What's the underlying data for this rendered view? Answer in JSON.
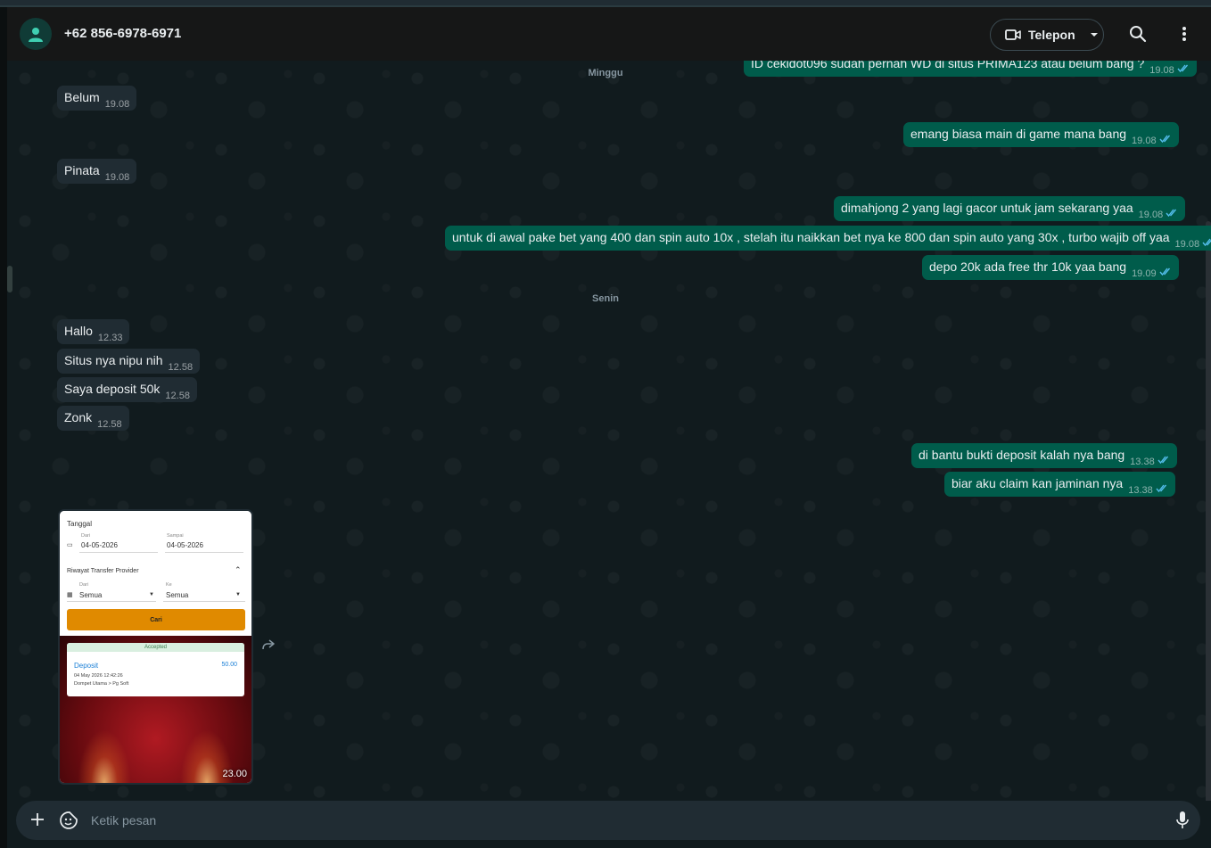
{
  "header": {
    "contact_name": "+62 856-6978-6971",
    "call_label": "Telepon"
  },
  "icons": {
    "avatar": "person-icon",
    "call": "video-camera-icon",
    "dropdown": "chevron-down-icon",
    "search": "search-icon",
    "menu": "kebab-menu-icon",
    "forward": "forward-icon",
    "attach": "plus-icon",
    "sticker": "sticker-icon",
    "mic": "microphone-icon",
    "read": "double-check-icon"
  },
  "colors": {
    "incoming_bubble": "#202c33",
    "outgoing_bubble": "#005c4b",
    "read_ticks": "#53bdeb",
    "cari_button": "#e08a00"
  },
  "chat": {
    "day_minggu": "Minggu",
    "day_senin": "Senin",
    "messages": [
      {
        "dir": "out",
        "text": "ID cekidot096 sudah pernah WD di situs PRIMA123 atau belum bang ?",
        "time": "19.08"
      },
      {
        "dir": "in",
        "text": "Belum",
        "time": "19.08"
      },
      {
        "dir": "out",
        "text": "emang biasa main di game mana bang",
        "time": "19.08"
      },
      {
        "dir": "in",
        "text": "Pinata",
        "time": "19.08"
      },
      {
        "dir": "out",
        "text": "dimahjong 2 yang lagi gacor untuk jam sekarang yaa",
        "time": "19.08"
      },
      {
        "dir": "out",
        "text": "untuk di awal pake bet yang 400 dan spin auto 10x , stelah itu naikkan bet nya ke 800 dan spin auto yang 30x , turbo wajib off yaa",
        "time": "19.08"
      },
      {
        "dir": "out",
        "text": "depo 20k ada free thr 10k yaa bang",
        "time": "19.09"
      },
      {
        "dir": "in",
        "text": "Hallo",
        "time": "12.33"
      },
      {
        "dir": "in",
        "text": "Situs nya nipu nih",
        "time": "12.58"
      },
      {
        "dir": "in",
        "text": "Saya deposit 50k",
        "time": "12.58"
      },
      {
        "dir": "in",
        "text": "Zonk",
        "time": "12.58"
      },
      {
        "dir": "out",
        "text": "di bantu bukti deposit kalah nya bang",
        "time": "13.38"
      },
      {
        "dir": "out",
        "text": "biar aku claim kan jaminan nya",
        "time": "13.38"
      }
    ],
    "image_message": {
      "time": "23.00",
      "form": {
        "tanggal_label": "Tanggal",
        "dari_label": "Dari",
        "dari_value": "04-05-2026",
        "sampai_label": "Sampai",
        "sampai_value": "04-05-2026",
        "riwayat_label": "Riwayat Transfer Provider",
        "dari2_label": "Dari",
        "dari2_value": "Semua",
        "ke_label": "Ke",
        "ke_value": "Semua",
        "cari_label": "Cari"
      },
      "transaction": {
        "status": "Accepted",
        "type": "Deposit",
        "amount": "50.00",
        "datetime": "04 May 2026 12:42:26",
        "route": "Dompet Utama > Pg Soft"
      }
    }
  },
  "composer": {
    "placeholder": "Ketik pesan"
  }
}
